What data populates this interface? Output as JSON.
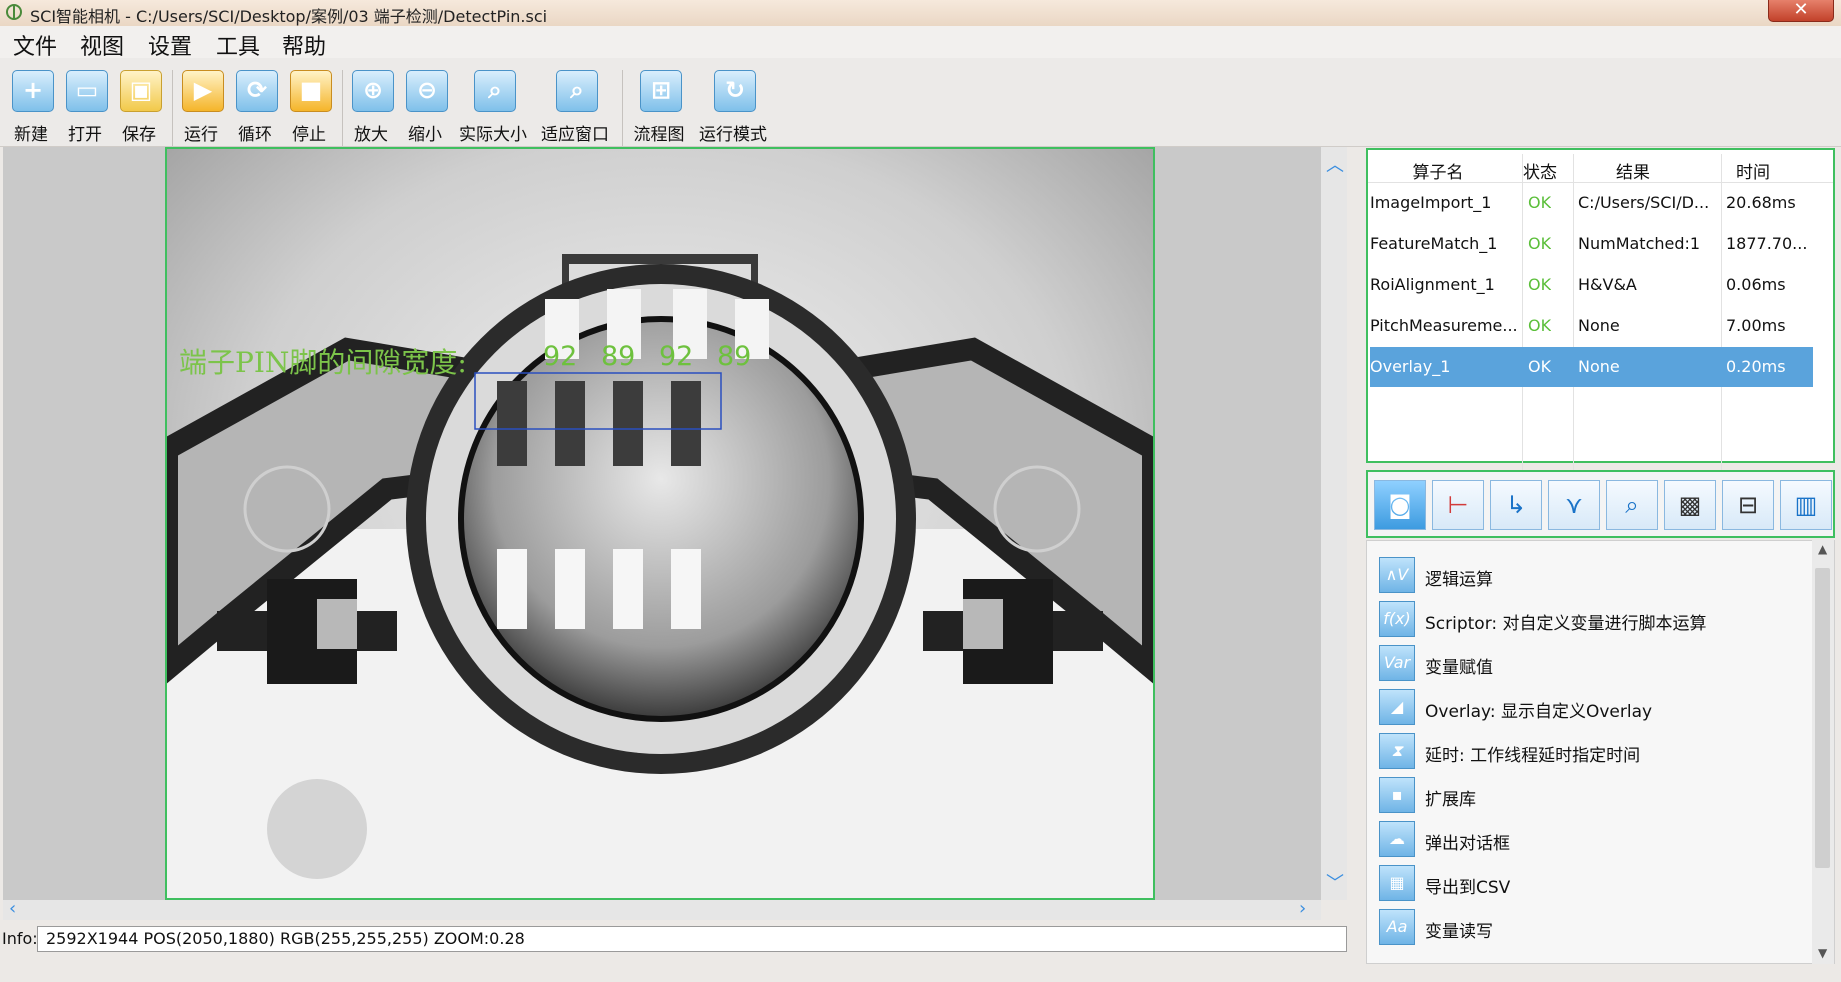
{
  "window": {
    "title": "SCI智能相机 - C:/Users/SCI/Desktop/案例/03 端子检测/DetectPin.sci",
    "close": "✕"
  },
  "menu": [
    "文件",
    "视图",
    "设置",
    "工具",
    "帮助"
  ],
  "toolbar": {
    "new": "新建",
    "open": "打开",
    "save": "保存",
    "run": "运行",
    "loop": "循环",
    "stop": "停止",
    "zoom_in": "放大",
    "zoom_out": "缩小",
    "actual_size": "实际大小",
    "fit_window": "适应窗口",
    "flowchart": "流程图",
    "run_mode": "运行模式"
  },
  "overlay": {
    "caption": "端子PIN脚的间隙宽度:",
    "values": [
      "92",
      "89",
      "92",
      "89"
    ]
  },
  "info": {
    "label": "Info:",
    "text": "2592X1944  POS(2050,1880)  RGB(255,255,255)  ZOOM:0.28"
  },
  "table": {
    "headers": [
      "算子名",
      "状态",
      "结果",
      "时间"
    ],
    "rows": [
      {
        "name": "ImageImport_1",
        "status": "OK",
        "result": "C:/Users/SCI/D...",
        "time": "20.68ms"
      },
      {
        "name": "FeatureMatch_1",
        "status": "OK",
        "result": "NumMatched:1",
        "time": "1877.70..."
      },
      {
        "name": "RoiAlignment_1",
        "status": "OK",
        "result": "H&V&A",
        "time": "0.06ms"
      },
      {
        "name": "PitchMeasureme...",
        "status": "OK",
        "result": "None",
        "time": "7.00ms"
      },
      {
        "name": "Overlay_1",
        "status": "OK",
        "result": "None",
        "time": "0.20ms"
      }
    ],
    "selected_index": 4
  },
  "tools": [
    {
      "icon": "∧V",
      "label": "逻辑运算"
    },
    {
      "icon": "f(x)",
      "label": "Scriptor: 对自定义变量进行脚本运算"
    },
    {
      "icon": "Var",
      "label": "变量赋值"
    },
    {
      "icon": "◢",
      "label": "Overlay: 显示自定义Overlay"
    },
    {
      "icon": "⧗",
      "label": "延时: 工作线程延时指定时间"
    },
    {
      "icon": "▪",
      "label": "扩展库"
    },
    {
      "icon": "☁",
      "label": "弹出对话框"
    },
    {
      "icon": "▦",
      "label": "导出到CSV"
    },
    {
      "icon": "Aa",
      "label": "变量读写"
    }
  ],
  "colors": {
    "accent_green": "#3fbf5f",
    "selection_blue": "#5aa3dc",
    "ok_green": "#5bbf3a"
  }
}
